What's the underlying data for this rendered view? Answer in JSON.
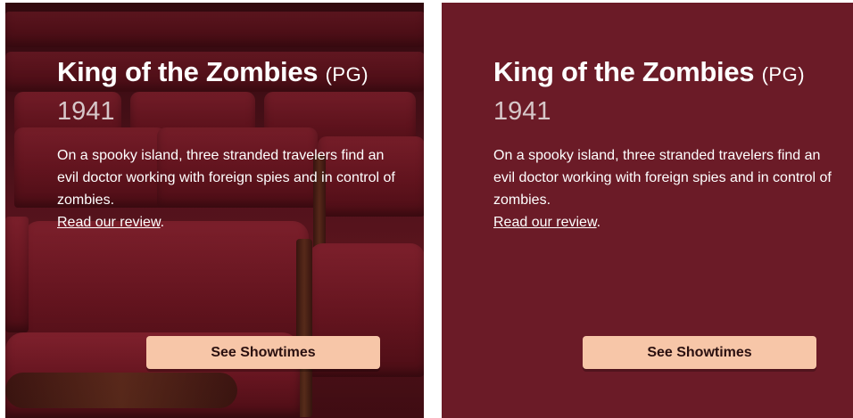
{
  "cards": [
    {
      "variant": "photo-background",
      "title": "King of the Zombies",
      "rating": "(PG)",
      "year": "1941",
      "description": "On a spooky island, three stranded travelers find an evil doctor working with foreign spies and in control of zombies.",
      "review_link": "Read our review",
      "review_suffix": ".",
      "button_label": "See Showtimes"
    },
    {
      "variant": "solid-background",
      "title": "King of the Zombies",
      "rating": "(PG)",
      "year": "1941",
      "description": "On a spooky island, three stranded travelers find an evil doctor working with foreign spies and in control of zombies.",
      "review_link": "Read our review",
      "review_suffix": ".",
      "button_label": "See Showtimes"
    }
  ],
  "colors": {
    "card_solid_bg": "#6b1b27",
    "button_bg": "#f7c6a8",
    "button_text": "#2a1010",
    "year_text": "#d7c7c9",
    "text": "#ffffff"
  }
}
